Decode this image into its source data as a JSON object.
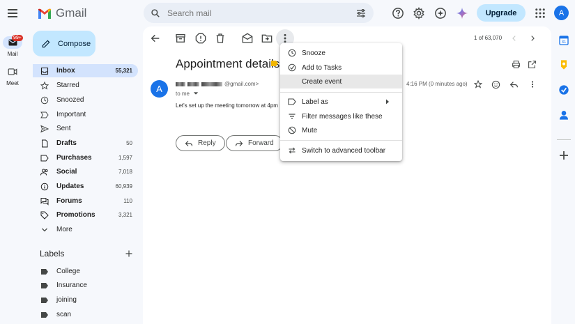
{
  "app": {
    "name": "Gmail"
  },
  "header": {
    "search_placeholder": "Search mail",
    "upgrade_label": "Upgrade",
    "avatar_letter": "A"
  },
  "rail": {
    "mail_label": "Mail",
    "mail_badge": "99+",
    "meet_label": "Meet"
  },
  "sidebar": {
    "compose_label": "Compose",
    "items": [
      {
        "label": "Inbox",
        "count": "55,321"
      },
      {
        "label": "Starred",
        "count": ""
      },
      {
        "label": "Snoozed",
        "count": ""
      },
      {
        "label": "Important",
        "count": ""
      },
      {
        "label": "Sent",
        "count": ""
      },
      {
        "label": "Drafts",
        "count": "50"
      },
      {
        "label": "Purchases",
        "count": "1,597"
      },
      {
        "label": "Social",
        "count": "7,018"
      },
      {
        "label": "Updates",
        "count": "60,939"
      },
      {
        "label": "Forums",
        "count": "110"
      },
      {
        "label": "Promotions",
        "count": "3,321"
      },
      {
        "label": "More",
        "count": ""
      }
    ],
    "labels_heading": "Labels",
    "labels": [
      "College",
      "Insurance",
      "joining",
      "scan"
    ]
  },
  "pager": {
    "text": "1 of 63,070"
  },
  "email": {
    "subject": "Appointment details",
    "sender_avatar": "A",
    "sender_email_suffix": "@gmail.com>",
    "to": "to me",
    "time": "4:16 PM (0 minutes ago)",
    "body": "Let's set up the meeting tomorrow at 4pm",
    "reply_label": "Reply",
    "forward_label": "Forward"
  },
  "menu": {
    "items": [
      {
        "label": "Snooze",
        "icon": "clock-icon"
      },
      {
        "label": "Add to Tasks",
        "icon": "add-task-icon"
      },
      {
        "label": "Create event",
        "icon": "calendar-icon"
      },
      {
        "label": "Label as",
        "icon": "label-icon"
      },
      {
        "label": "Filter messages like these",
        "icon": "filter-icon"
      },
      {
        "label": "Mute",
        "icon": "mute-icon"
      },
      {
        "label": "Switch to advanced toolbar",
        "icon": "swap-icon"
      }
    ]
  },
  "colors": {
    "accent": "#c2e7ff",
    "active_nav": "#d3e3fd",
    "brand_red": "#ea4335",
    "important": "#f2b600"
  }
}
